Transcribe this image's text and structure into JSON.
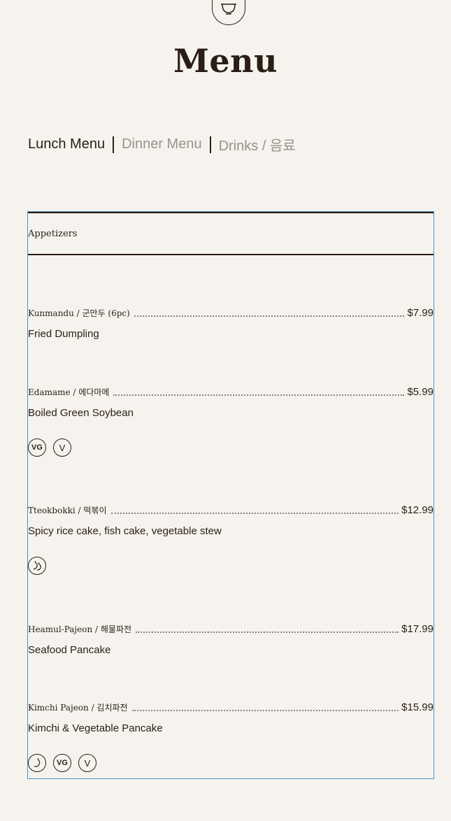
{
  "header": {
    "logo_icon": "bowl-icon",
    "title": "Menu"
  },
  "tabs": [
    {
      "label": "Lunch Menu",
      "active": true
    },
    {
      "label": "Dinner Menu",
      "active": false
    },
    {
      "label": "Drinks / 음료",
      "active": false
    }
  ],
  "section": {
    "title": "Appetizers",
    "items": [
      {
        "name": "Kunmandu / 군만두 (6pc)",
        "price": "$7.99",
        "description": "Fried Dumpling",
        "badges": []
      },
      {
        "name": "Edamame / 에다마메",
        "price": "$5.99",
        "description": "Boiled Green Soybean",
        "badges": [
          "VG",
          "V"
        ]
      },
      {
        "name": "Tteokbokki / 떡볶이",
        "price": "$12.99",
        "description": "Spicy rice cake, fish cake, vegetable stew",
        "badges": [
          "spicy-2-icon"
        ]
      },
      {
        "name": "Heamul-Pajeon / 해물파전",
        "price": "$17.99",
        "description": "Seafood Pancake",
        "badges": []
      },
      {
        "name": "Kimchi Pajeon / 김치파전",
        "price": "$15.99",
        "description": "Kimchi & Vegetable Pancake",
        "badges": [
          "spicy-1-icon",
          "VG",
          "V"
        ]
      }
    ]
  },
  "colors": {
    "background": "#f6f3ef",
    "text": "#2a1d14",
    "inactive_tab": "#9a918b",
    "panel_border": "#4a90c8"
  }
}
